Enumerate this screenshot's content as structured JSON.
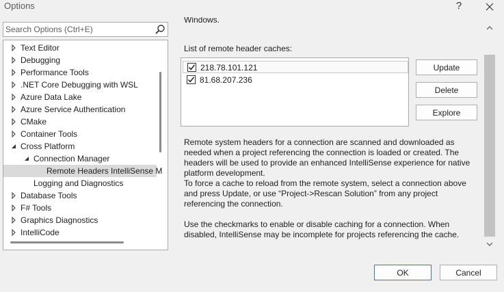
{
  "window": {
    "title": "Options",
    "help_icon": "?",
    "close_icon": "close-icon"
  },
  "search": {
    "placeholder": "Search Options (Ctrl+E)"
  },
  "tree": {
    "items": [
      {
        "label": "Text Editor",
        "expander": "collapsed"
      },
      {
        "label": "Debugging",
        "expander": "collapsed"
      },
      {
        "label": "Performance Tools",
        "expander": "collapsed"
      },
      {
        "label": ".NET Core Debugging with WSL",
        "expander": "collapsed"
      },
      {
        "label": "Azure Data Lake",
        "expander": "collapsed"
      },
      {
        "label": "Azure Service Authentication",
        "expander": "collapsed"
      },
      {
        "label": "CMake",
        "expander": "collapsed"
      },
      {
        "label": "Container Tools",
        "expander": "collapsed"
      },
      {
        "label": "Cross Platform",
        "expander": "expanded"
      },
      {
        "label": "Connection Manager",
        "expander": "expanded"
      },
      {
        "label": "Remote Headers IntelliSense M",
        "expander": "none",
        "selected": true
      },
      {
        "label": "Logging and Diagnostics",
        "expander": "none"
      },
      {
        "label": "Database Tools",
        "expander": "collapsed"
      },
      {
        "label": "F# Tools",
        "expander": "collapsed"
      },
      {
        "label": "Graphics Diagnostics",
        "expander": "collapsed"
      },
      {
        "label": "IntelliCode",
        "expander": "collapsed"
      }
    ]
  },
  "panel": {
    "cut_text": "Windows.",
    "list_caption": "List of remote header caches:",
    "caches": [
      {
        "address": "218.78.101.121",
        "checked": true
      },
      {
        "address": "81.68.207.236",
        "checked": true
      }
    ],
    "buttons": {
      "update": "Update",
      "delete": "Delete",
      "explore": "Explore"
    },
    "description": {
      "para1": "Remote system headers for a connection are scanned and downloaded as needed when a project referencing the connection is loaded or created. The headers will be used to provide an enhanced IntelliSense experience for native platform development.",
      "para2": "To force a cache to reload from the remote system, select a connection above and press Update, or use “Project->Rescan Solution” from any project referencing the connection.",
      "para3": "Use the checkmarks to enable or disable caching for a connection. When disabled, IntelliSense may be incomplete for projects referencing the cache."
    }
  },
  "footer": {
    "ok": "OK",
    "cancel": "Cancel"
  },
  "colors": {
    "accent": "#2c7bd0",
    "selection": "#dadada",
    "scrollbar": "#c2c2c2"
  }
}
